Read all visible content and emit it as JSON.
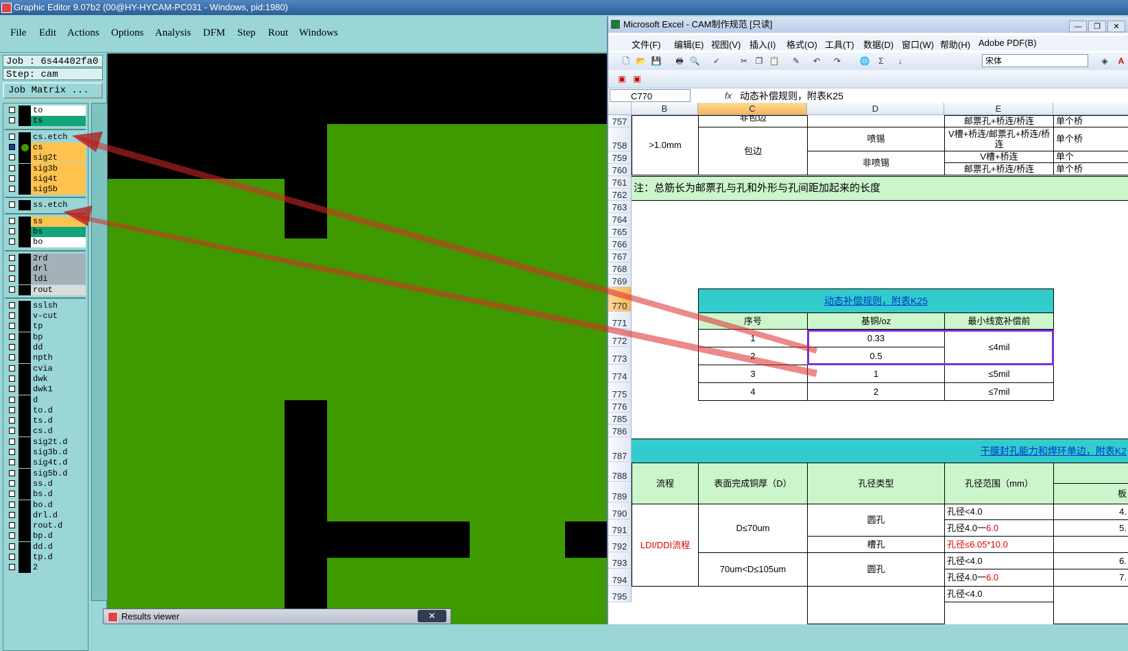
{
  "graphic_editor": {
    "title": "Graphic Editor 9.07b2 (00@HY-HYCAM-PC031 - Windows, pid:1980)",
    "menu": [
      "File",
      "Edit",
      "Actions",
      "Options",
      "Analysis",
      "DFM",
      "Step",
      "Rout",
      "Windows"
    ],
    "job_label": "Job : 6s44402fa0",
    "step_label": "Step: cam",
    "job_matrix_button": "Job Matrix ...",
    "layers": [
      {
        "name": "to",
        "color": "#ffffff"
      },
      {
        "name": "ts",
        "color": "#13a57a"
      },
      {
        "name": "cs.etch",
        "color": "#9bd6d6"
      },
      {
        "name": "cs",
        "color": "#ffc34d",
        "active": true
      },
      {
        "name": "sig2t",
        "color": "#ffc34d"
      },
      {
        "name": "sig3b",
        "color": "#ffc34d"
      },
      {
        "name": "sig4t",
        "color": "#ffc34d"
      },
      {
        "name": "sig5b",
        "color": "#ffc34d"
      },
      {
        "name": "ss.etch",
        "color": "#9bd6d6"
      },
      {
        "name": "ss",
        "color": "#ffc34d"
      },
      {
        "name": "bs",
        "color": "#13a57a"
      },
      {
        "name": "bo",
        "color": "#ffffff"
      },
      {
        "name": "2rd",
        "color": "#a3b2b8"
      },
      {
        "name": "drl",
        "color": "#a3b2b8"
      },
      {
        "name": "ldi",
        "color": "#a3b2b8"
      },
      {
        "name": "rout",
        "color": "#d7dcdc"
      },
      {
        "name": "sslsh",
        "color": "#9bd6d6"
      },
      {
        "name": "v-cut",
        "color": "#9bd6d6"
      },
      {
        "name": "tp",
        "color": "#9bd6d6"
      },
      {
        "name": "bp",
        "color": "#9bd6d6"
      },
      {
        "name": "dd",
        "color": "#9bd6d6"
      },
      {
        "name": "npth",
        "color": "#9bd6d6"
      },
      {
        "name": "cvia",
        "color": "#9bd6d6"
      },
      {
        "name": "dwk",
        "color": "#9bd6d6"
      },
      {
        "name": "dwk1",
        "color": "#9bd6d6"
      },
      {
        "name": "d",
        "color": "#9bd6d6"
      },
      {
        "name": "to.d",
        "color": "#9bd6d6"
      },
      {
        "name": "ts.d",
        "color": "#9bd6d6"
      },
      {
        "name": "cs.d",
        "color": "#9bd6d6"
      },
      {
        "name": "sig2t.d",
        "color": "#9bd6d6"
      },
      {
        "name": "sig3b.d",
        "color": "#9bd6d6"
      },
      {
        "name": "sig4t.d",
        "color": "#9bd6d6"
      },
      {
        "name": "sig5b.d",
        "color": "#9bd6d6"
      },
      {
        "name": "ss.d",
        "color": "#9bd6d6"
      },
      {
        "name": "bs.d",
        "color": "#9bd6d6"
      },
      {
        "name": "bo.d",
        "color": "#9bd6d6"
      },
      {
        "name": "drl.d",
        "color": "#9bd6d6"
      },
      {
        "name": "rout.d",
        "color": "#9bd6d6"
      },
      {
        "name": "bp.d",
        "color": "#9bd6d6"
      },
      {
        "name": "dd.d",
        "color": "#9bd6d6"
      },
      {
        "name": "tp.d",
        "color": "#9bd6d6"
      },
      {
        "name": "2",
        "color": "#9bd6d6"
      }
    ],
    "canvas_colors": {
      "background": "#000000",
      "copper": "#3e9a00"
    },
    "results_viewer_title": "Results viewer",
    "close_label": "✕"
  },
  "excel": {
    "title": "Microsoft Excel - CAM制作规范  [只读]",
    "window_buttons": [
      "—",
      "❐",
      "✕"
    ],
    "menu": [
      "文件(F)",
      "编辑(E)",
      "视图(V)",
      "插入(I)",
      "格式(O)",
      "工具(T)",
      "数据(D)",
      "窗口(W)",
      "帮助(H)",
      "Adobe PDF(B)"
    ],
    "font_name": "宋体",
    "name_box": "C770",
    "fx": "fx",
    "formula": "动态补偿规则，附表K25",
    "columns": [
      "B",
      "C",
      "D",
      "E"
    ],
    "rows": [
      "757",
      "758",
      "759",
      "760",
      "761",
      "762",
      "763",
      "764",
      "765",
      "766",
      "767",
      "768",
      "769",
      "770",
      "771",
      "772",
      "773",
      "774",
      "775",
      "776",
      "785",
      "786",
      "787",
      "788",
      "789",
      "790",
      "791",
      "792",
      "793",
      "794",
      "795"
    ],
    "top_table": {
      "b_757": ">1.0mm",
      "c_757": "非包边",
      "c_758": "包边",
      "d_758": "喷锡",
      "d_760": "非喷锡",
      "e_757": "邮票孔+桥连/桥连",
      "e_758": "V槽+桥连/邮票孔+桥连/桥连",
      "e_759": "V槽+桥连",
      "e_760": "邮票孔+桥连/桥连",
      "f_757": "单个桥",
      "f_758": "单个桥",
      "f_759": "单个",
      "f_760": "单个桥"
    },
    "note": "注：总筋长为邮票孔与孔和外形与孔间距加起来的长度",
    "k25": {
      "title": "动态补偿规则，附表K25",
      "headers": [
        "序号",
        "基铜/oz",
        "最小线宽补偿前"
      ],
      "rows": [
        [
          "1",
          "0.33",
          "≤4mil"
        ],
        [
          "2",
          "0.5",
          ""
        ],
        [
          "3",
          "1",
          "≤5mil"
        ],
        [
          "4",
          "2",
          "≤7mil"
        ]
      ]
    },
    "dryfilm": {
      "title": "干膜封孔能力和焊环单边，附表K2",
      "headers": [
        "流程",
        "表面完成铜厚（D）",
        "孔径类型",
        "孔径范围（mm）"
      ],
      "extra_header": "板",
      "process": "LDI/DDI流程",
      "thk1": "D≤70um",
      "thk2": "70um<D≤105um",
      "round": "圆孔",
      "slot": "槽孔",
      "r790": "孔径<4.0",
      "r791a": "孔径4.0一",
      "r791b": "6.0",
      "r792": "孔径≤6.05*10.0",
      "r793": "孔径<4.0",
      "r794a": "孔径4.0一",
      "r794b": "6.0",
      "r795": "孔径<4.0",
      "f790": "4.",
      "f791": "5.",
      "f793": "6.",
      "f794": "7."
    }
  }
}
